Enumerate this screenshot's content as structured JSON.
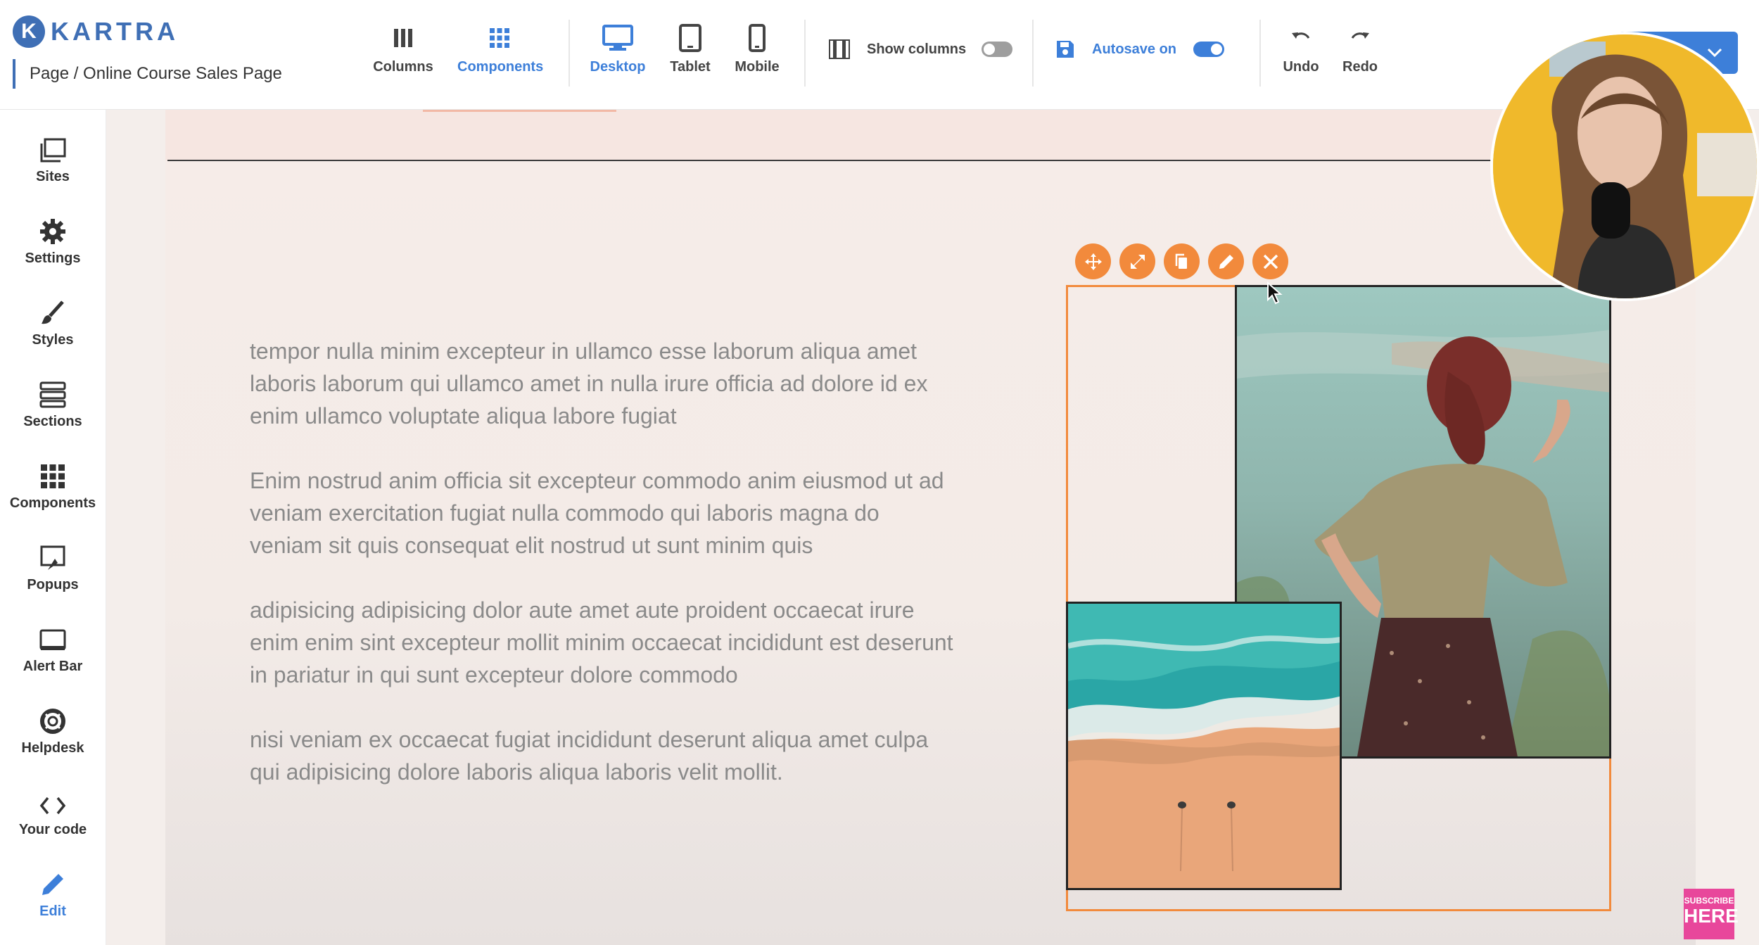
{
  "app": {
    "logo_text": "KARTRA",
    "logo_letter": "K"
  },
  "breadcrumb": {
    "text": "Page / Online Course Sales Page"
  },
  "toolbar": {
    "columns_label": "Columns",
    "components_label": "Components",
    "desktop_label": "Desktop",
    "tablet_label": "Tablet",
    "mobile_label": "Mobile",
    "show_columns_label": "Show columns",
    "show_columns_on": false,
    "autosave_label": "Autosave on",
    "autosave_on": true,
    "undo_label": "Undo",
    "redo_label": "Redo",
    "active_view": "Desktop",
    "accent_color": "#3d7fd9"
  },
  "sidebar": {
    "items": [
      {
        "label": "Sites",
        "icon": "sites-icon"
      },
      {
        "label": "Settings",
        "icon": "gear-icon"
      },
      {
        "label": "Styles",
        "icon": "brush-icon"
      },
      {
        "label": "Sections",
        "icon": "sections-icon"
      },
      {
        "label": "Components",
        "icon": "grid-icon"
      },
      {
        "label": "Popups",
        "icon": "popup-icon"
      },
      {
        "label": "Alert Bar",
        "icon": "alert-bar-icon"
      },
      {
        "label": "Helpdesk",
        "icon": "lifebuoy-icon"
      },
      {
        "label": "Your code",
        "icon": "code-icon"
      },
      {
        "label": "Edit",
        "icon": "pencil-icon"
      }
    ],
    "active": "Edit"
  },
  "content": {
    "paragraphs": [
      "tempor nulla minim excepteur in ullamco esse laborum aliqua amet laboris laborum qui ullamco amet in nulla irure officia ad dolore id ex enim ullamco voluptate aliqua labore fugiat",
      "Enim nostrud anim officia sit excepteur commodo anim eiusmod ut ad veniam exercitation fugiat nulla commodo qui laboris magna do veniam sit quis consequat elit nostrud ut sunt minim quis",
      "adipisicing adipisicing dolor aute amet aute proident occaecat irure enim enim sint excepteur mollit minim occaecat incididunt est deserunt in pariatur in qui sunt excepteur dolore commodo",
      "nisi veniam ex occaecat fugiat incididunt deserunt aliqua amet culpa qui adipisicing dolore laboris aliqua laboris velit mollit."
    ]
  },
  "component_actions": [
    "move-icon",
    "resize-icon",
    "duplicate-icon",
    "edit-icon",
    "delete-icon"
  ],
  "selection_color": "#f28a3c",
  "overlay": {
    "subscribe_small": "SUBSCRIBE",
    "subscribe_big": "HERE"
  }
}
